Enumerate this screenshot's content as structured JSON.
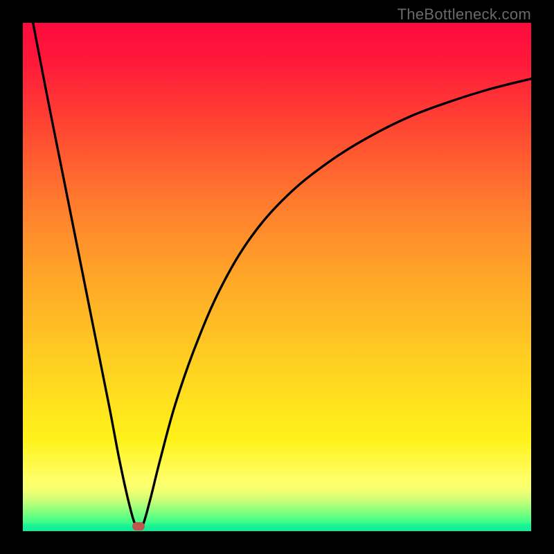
{
  "attribution": "TheBottleneck.com",
  "chart_data": {
    "type": "line",
    "title": "",
    "xlabel": "",
    "ylabel": "",
    "xlim": [
      0,
      100
    ],
    "ylim": [
      0,
      100
    ],
    "grid": false,
    "legend": false,
    "background_gradient": {
      "direction": "vertical",
      "stops": [
        {
          "pos": 0.0,
          "color": "#ff0a3e"
        },
        {
          "pos": 0.2,
          "color": "#ff4432"
        },
        {
          "pos": 0.5,
          "color": "#ffa628"
        },
        {
          "pos": 0.82,
          "color": "#fff21a"
        },
        {
          "pos": 0.92,
          "color": "#f4ff70"
        },
        {
          "pos": 0.98,
          "color": "#45ff88"
        },
        {
          "pos": 1.0,
          "color": "#0eec96"
        }
      ]
    },
    "series": [
      {
        "name": "bounce-curve",
        "color": "#000000",
        "x": [
          2.0,
          5.0,
          8.0,
          11.0,
          14.0,
          17.0,
          19.0,
          21.0,
          22.3,
          23.5,
          25.0,
          27.0,
          30.0,
          34.0,
          39.0,
          45.0,
          52.0,
          60.0,
          68.0,
          76.0,
          84.0,
          92.0,
          100.0
        ],
        "y": [
          100.0,
          84.5,
          69.5,
          54.5,
          39.5,
          24.5,
          14.0,
          5.0,
          1.0,
          1.0,
          6.0,
          14.0,
          25.0,
          36.5,
          48.0,
          58.0,
          66.0,
          72.5,
          77.5,
          81.5,
          84.5,
          87.0,
          89.0
        ]
      }
    ],
    "markers": [
      {
        "name": "vertex-marker",
        "x": 22.8,
        "y": 1.0,
        "color": "#c0544e",
        "shape": "rounded-rect"
      }
    ]
  }
}
